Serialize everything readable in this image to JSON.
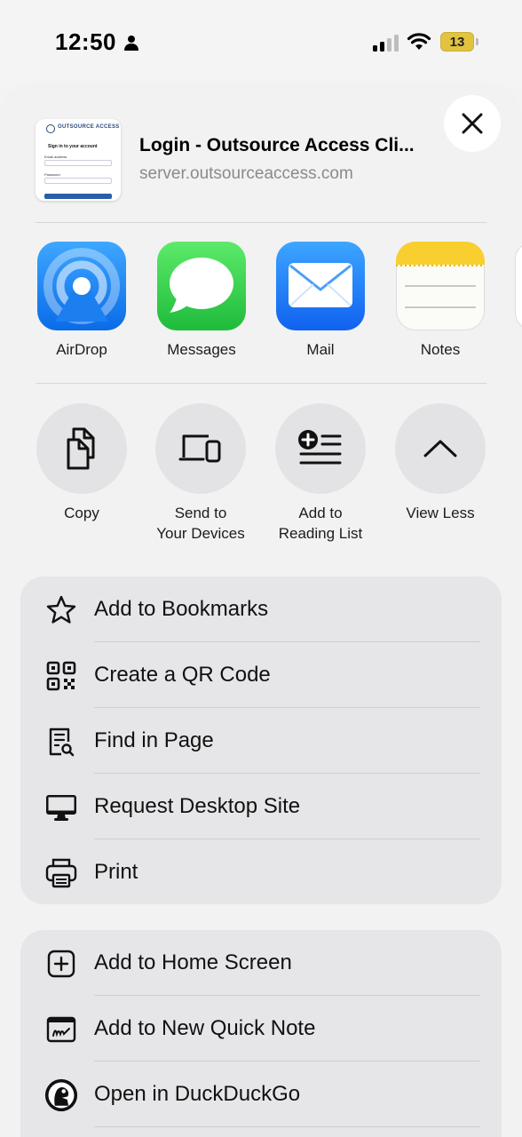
{
  "status_bar": {
    "time": "12:50",
    "battery": "13",
    "battery_level": 0.13,
    "signal_bars": 4,
    "signal_active": 2
  },
  "share_header": {
    "title": "Login - Outsource Access Cli...",
    "url": "server.outsourceaccess.com",
    "thumbnail": {
      "brand": "OUTSOURCE ACCESS",
      "heading": "Sign in to your account",
      "email_label": "Email address",
      "password_label": "Password",
      "button": "Sign in"
    }
  },
  "apps": [
    {
      "label": "AirDrop",
      "icon": "airdrop-icon"
    },
    {
      "label": "Messages",
      "icon": "messages-icon"
    },
    {
      "label": "Mail",
      "icon": "mail-icon"
    },
    {
      "label": "Notes",
      "icon": "notes-icon"
    }
  ],
  "actions": [
    {
      "label": "Copy",
      "icon": "copy-icon"
    },
    {
      "label": "Send to\nYour Devices",
      "line1": "Send to",
      "line2": "Your Devices",
      "icon": "devices-icon"
    },
    {
      "label": "Add to\nReading List",
      "line1": "Add to",
      "line2": "Reading List",
      "icon": "reading-list-icon"
    },
    {
      "label": "View Less",
      "icon": "chevron-up-icon"
    }
  ],
  "group1": [
    {
      "label": "Add to Bookmarks",
      "icon": "star-icon"
    },
    {
      "label": "Create a QR Code",
      "icon": "qr-code-icon"
    },
    {
      "label": "Find in Page",
      "icon": "find-in-page-icon"
    },
    {
      "label": "Request Desktop Site",
      "icon": "desktop-icon"
    },
    {
      "label": "Print",
      "icon": "printer-icon"
    }
  ],
  "group2": [
    {
      "label": "Add to Home Screen",
      "icon": "add-square-icon"
    },
    {
      "label": "Add to New Quick Note",
      "icon": "quick-note-icon"
    },
    {
      "label": "Open in DuckDuckGo",
      "icon": "duckduckgo-icon"
    }
  ],
  "colors": {
    "accent_blue": "#0a6be8",
    "green": "#1fbb3b",
    "notes_yellow": "#f8cf2f",
    "battery": "#e2c33f"
  }
}
